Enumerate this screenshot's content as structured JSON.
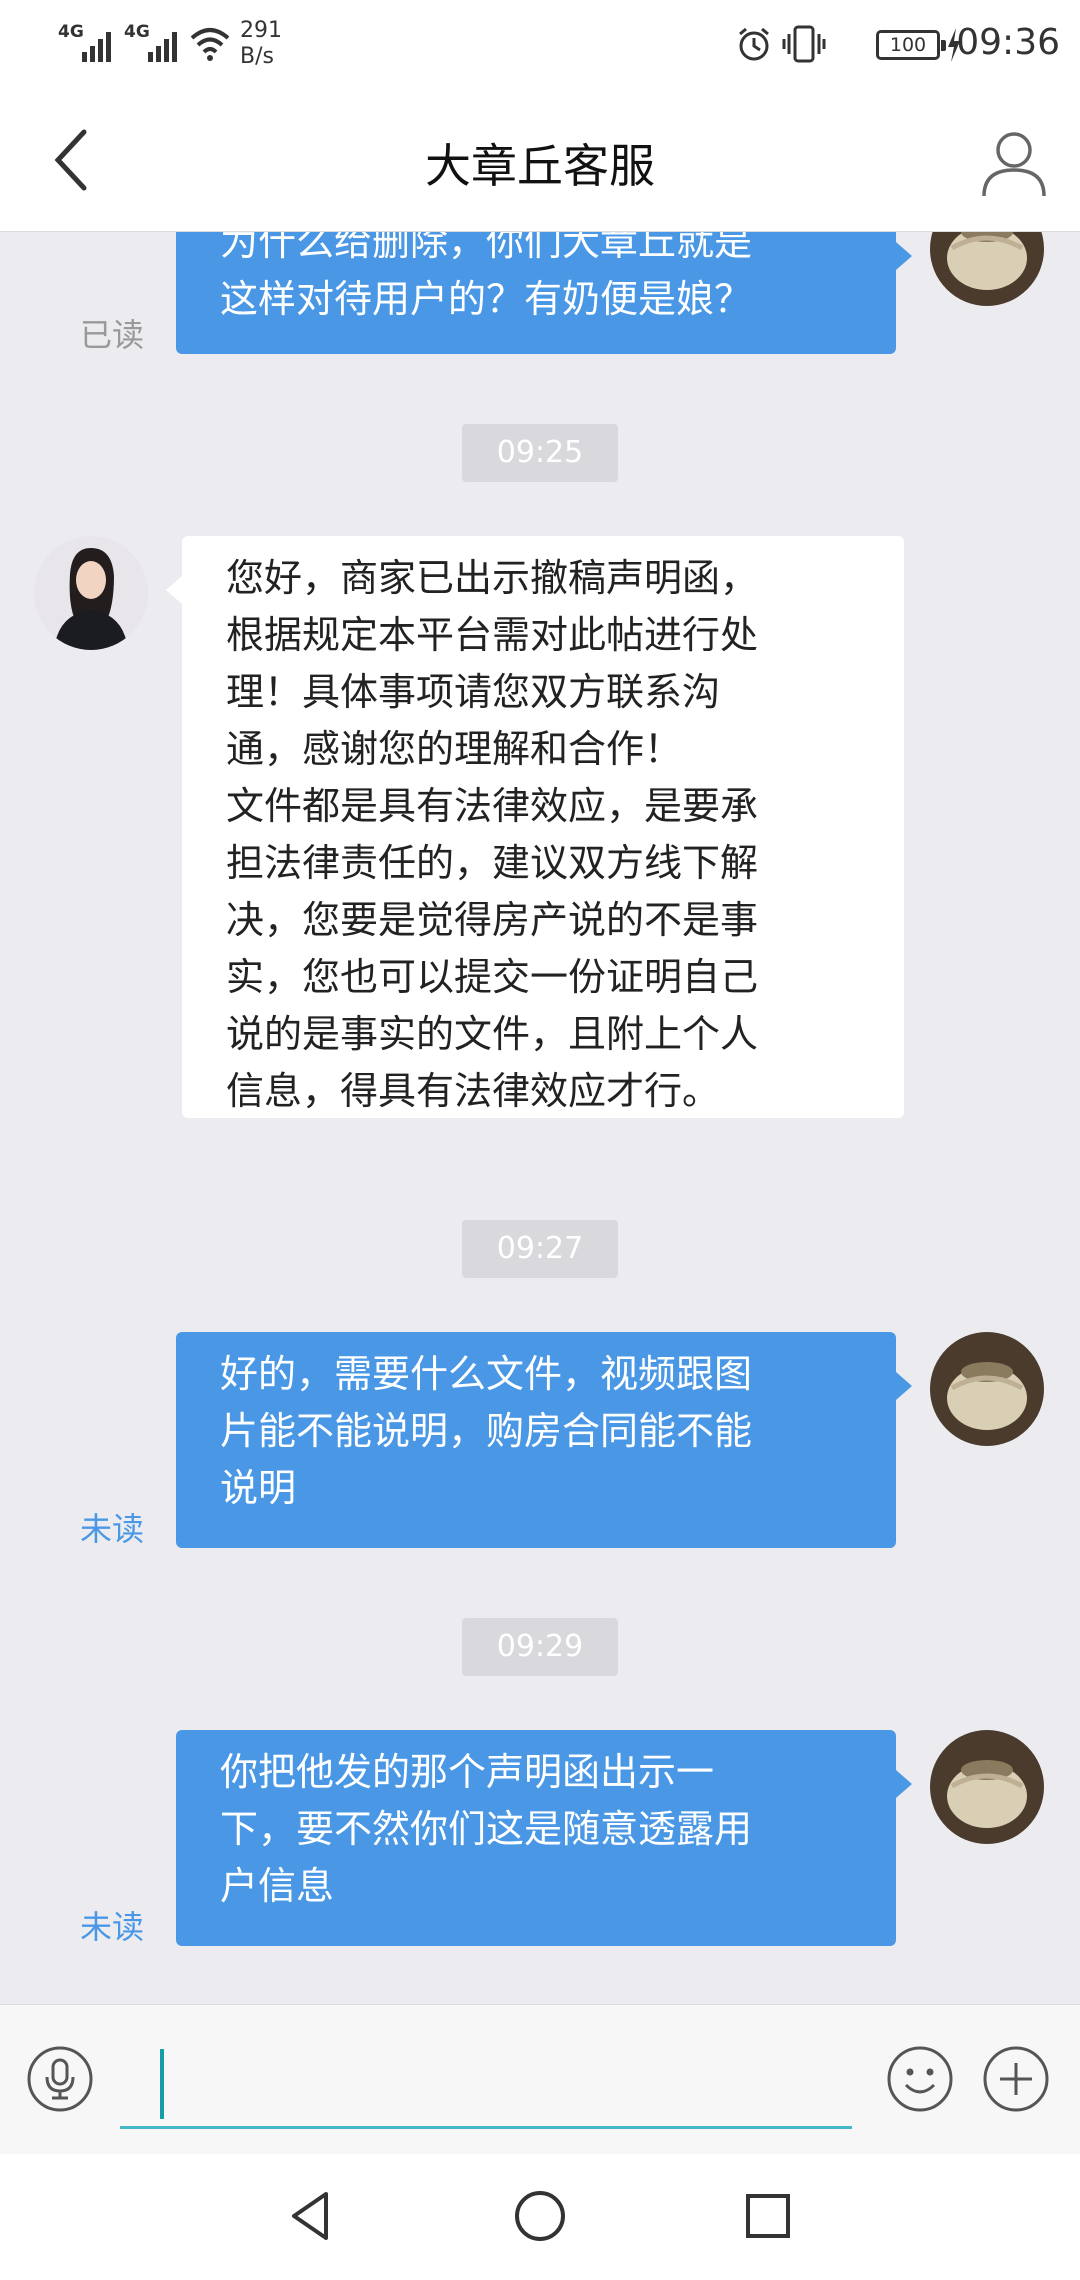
{
  "status_bar": {
    "network_1": "4G",
    "network_2": "4G",
    "speed_value": "291",
    "speed_unit": "B/s",
    "battery": "100",
    "time": "09:36"
  },
  "header": {
    "title": "大章丘客服",
    "back_icon": "chevron-left-icon",
    "profile_icon": "user-icon"
  },
  "messages": [
    {
      "direction": "outgoing",
      "lines": [
        "为什么给删除，你们大章丘就是",
        "这样对待用户的？有奶便是娘？"
      ],
      "receipt": "已读"
    },
    {
      "type": "time",
      "text": "09:25"
    },
    {
      "direction": "incoming",
      "lines": [
        "您好，商家已出示撤稿声明函，",
        "根据规定本平台需对此帖进行处",
        "理！具体事项请您双方联系沟",
        "通，感谢您的理解和合作！",
        "文件都是具有法律效应，是要承",
        "担法律责任的，建议双方线下解",
        "决，您要是觉得房产说的不是事",
        "实，您也可以提交一份证明自己",
        "说的是事实的文件，且附上个人",
        "信息，得具有法律效应才行。"
      ]
    },
    {
      "type": "time",
      "text": "09:27"
    },
    {
      "direction": "outgoing",
      "lines": [
        "好的，需要什么文件，视频跟图",
        "片能不能说明，购房合同能不能",
        "说明"
      ],
      "receipt": "未读"
    },
    {
      "type": "time",
      "text": "09:29"
    },
    {
      "direction": "outgoing",
      "lines": [
        "你把他发的那个声明函出示一",
        "下，要不然你们这是随意透露用",
        "户信息"
      ],
      "receipt": "未读"
    }
  ],
  "input_bar": {
    "value": "",
    "voice_icon": "microphone-icon",
    "emoji_icon": "smiley-icon",
    "more_icon": "plus-icon"
  },
  "nav_bar": {
    "back_icon": "triangle-back-icon",
    "home_icon": "circle-home-icon",
    "recents_icon": "square-recents-icon"
  },
  "colors": {
    "outgoing_bubble": "#4a98e5",
    "incoming_bubble": "#ffffff",
    "chat_background": "#ececf0",
    "unread_receipt": "#4a98e5",
    "input_underline": "#47b8c8"
  }
}
